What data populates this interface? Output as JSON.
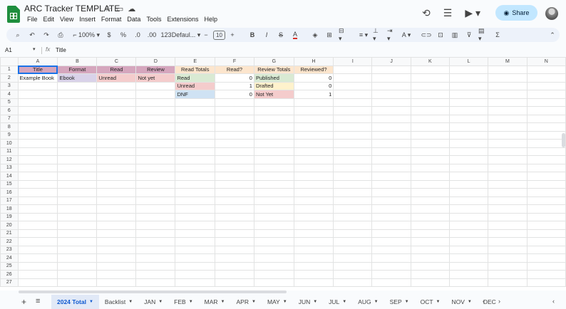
{
  "doc": {
    "title": "ARC Tracker TEMPLATE",
    "menu": [
      "File",
      "Edit",
      "View",
      "Insert",
      "Format",
      "Data",
      "Tools",
      "Extensions",
      "Help"
    ],
    "share_label": "Share"
  },
  "toolbar": {
    "zoom": "100%",
    "currency": "$",
    "percent": "%",
    "decrease_decimal": ".0",
    "increase_decimal": ".00",
    "number_format": "123",
    "font": "Defaul...",
    "font_size": "10",
    "bold": "B",
    "italic": "I",
    "strike": "S",
    "text_color": "A",
    "minus": "−",
    "plus": "+"
  },
  "formula_bar": {
    "cell_ref": "A1",
    "fx": "fx",
    "value": "Title"
  },
  "columns": [
    "A",
    "B",
    "C",
    "D",
    "E",
    "F",
    "G",
    "H",
    "I",
    "J",
    "K",
    "L",
    "M",
    "N"
  ],
  "rows": {
    "header": {
      "title": "Title",
      "format": "Format",
      "read": "Read",
      "review": "Review",
      "read_totals": "Read Totals",
      "read_q": "Read?",
      "review_totals": "Review Totals",
      "reviewed_q": "Reviewed?"
    },
    "r2": {
      "a": "Example Book",
      "b": "Ebook",
      "c": "Unread",
      "d": "Not yet",
      "e": "Read",
      "f": "0",
      "g": "Published",
      "h": "0"
    },
    "r3": {
      "e": "Unread",
      "f": "1",
      "g": "Drafted",
      "h": "0"
    },
    "r4": {
      "e": "DNF",
      "f": "0",
      "g": "Not Yet",
      "h": "1"
    }
  },
  "colors": {
    "header_pink": "#d5a6bd",
    "summary_orange": "#fce5cd",
    "ebook_purple": "#d9d2e9",
    "unread_red": "#f4cccc",
    "read_green": "#d9ead3",
    "dnf_blue": "#cfe2f3",
    "drafted_yellow": "#fff2cc",
    "share_bg": "#c2e7ff",
    "active_tab": "#0b57d0"
  },
  "sheet_tabs": [
    "2024 Total",
    "Backlist",
    "JAN",
    "FEB",
    "MAR",
    "APR",
    "MAY",
    "JUN",
    "JUL",
    "AUG",
    "SEP",
    "OCT",
    "NOV",
    "DEC"
  ],
  "icons": [
    "history-icon",
    "comment-icon",
    "video-call-icon",
    "share-globe-icon",
    "star-icon",
    "folder-icon",
    "cloud-icon"
  ]
}
